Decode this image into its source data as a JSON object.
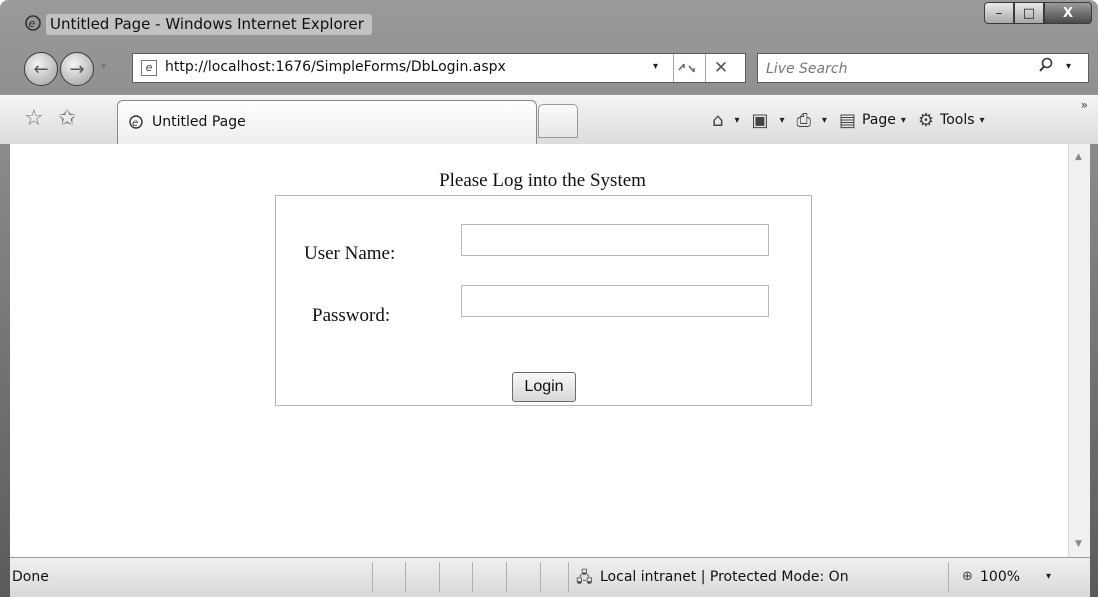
{
  "window": {
    "title": "Untitled Page - Windows Internet Explorer",
    "minimize_glyph": "–",
    "maximize_glyph": "□",
    "close_glyph": "X"
  },
  "toolbar": {
    "back_glyph": "←",
    "forward_glyph": "→",
    "recent_glyph": "▾",
    "address": "http://localhost:1676/SimpleForms/DbLogin.aspx",
    "address_dropdown_glyph": "▾",
    "refresh_glyph": "⁴⁄",
    "stop_glyph": "✕",
    "search_placeholder": "Live Search",
    "search_glyph": "⚲",
    "search_dropdown_glyph": "▾"
  },
  "tabs": {
    "favorites_glyph": "☆",
    "add_favorites_glyph": "✩",
    "active_tab_label": "Untitled Page",
    "overflow_glyph": "»"
  },
  "commands": {
    "home_glyph": "⌂",
    "feeds_glyph": "▣",
    "print_glyph": "⎙",
    "page_glyph": "▤",
    "page_label": "Page",
    "tools_glyph": "⚙",
    "tools_label": "Tools",
    "dropdown_glyph": "▾"
  },
  "form": {
    "heading": "Please Log into the System",
    "username_label": "User Name:",
    "password_label": "Password:",
    "login_button": "Login",
    "username_value": "",
    "password_value": ""
  },
  "scroll": {
    "up_glyph": "▲",
    "down_glyph": "▼"
  },
  "status": {
    "text": "Done",
    "zone_glyph": "🖧",
    "zone": "Local intranet | Protected Mode: On",
    "zoom_glyph": "⊕",
    "zoom": "100%",
    "zoom_dropdown_glyph": "▾"
  }
}
